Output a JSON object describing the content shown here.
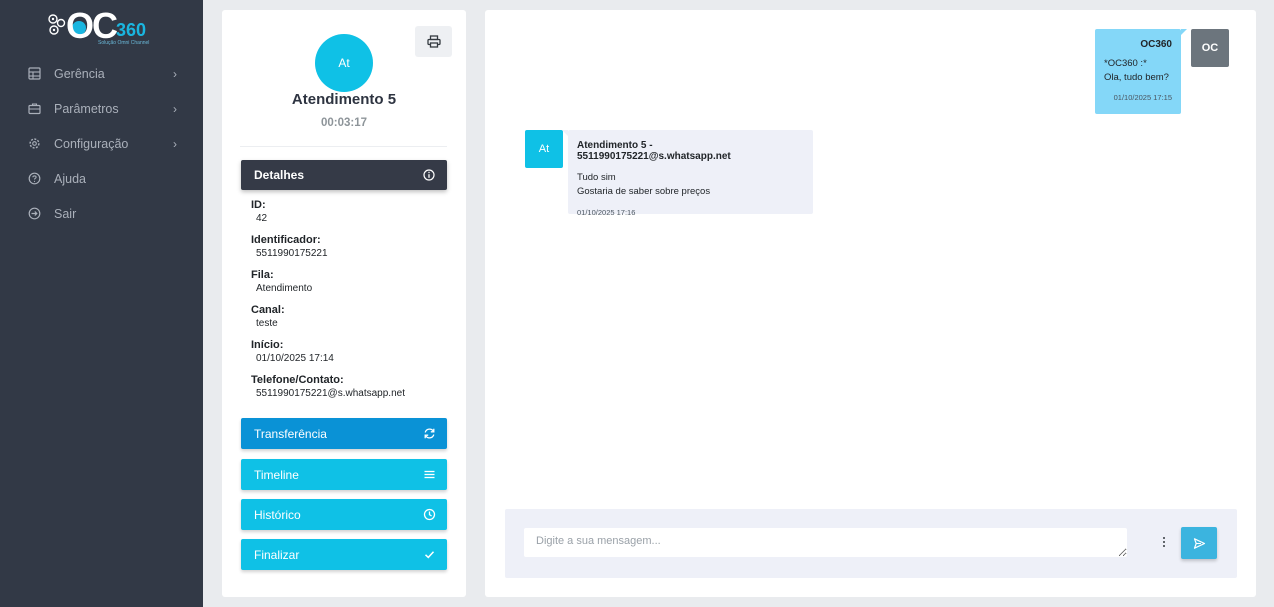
{
  "logo": {
    "brand": "OC",
    "number": "360",
    "tagline": "Solução Omni Channel"
  },
  "sidebar": {
    "items": [
      {
        "label": "Gerência",
        "icon": "server-icon",
        "has_submenu": true
      },
      {
        "label": "Parâmetros",
        "icon": "briefcase-icon",
        "has_submenu": true
      },
      {
        "label": "Configuração",
        "icon": "gear-icon",
        "has_submenu": true
      },
      {
        "label": "Ajuda",
        "icon": "help-circle-icon",
        "has_submenu": false
      },
      {
        "label": "Sair",
        "icon": "logout-icon",
        "has_submenu": false
      }
    ]
  },
  "contact": {
    "avatar_initials": "At",
    "name": "Atendimento 5",
    "timer": "00:03:17"
  },
  "details": {
    "header": "Detalhes",
    "fields": [
      {
        "label": "ID:",
        "value": "42"
      },
      {
        "label": "Identificador:",
        "value": "5511990175221"
      },
      {
        "label": "Fila:",
        "value": "Atendimento"
      },
      {
        "label": "Canal:",
        "value": "teste"
      },
      {
        "label": "Início:",
        "value": "01/10/2025 17:14"
      },
      {
        "label": "Telefone/Contato:",
        "value": "5511990175221@s.whatsapp.net"
      }
    ]
  },
  "actions": {
    "transfer": "Transferência",
    "timeline": "Timeline",
    "history": "Histórico",
    "finish": "Finalizar"
  },
  "chat": {
    "outgoing": {
      "avatar": "OC",
      "sender": "OC360",
      "line1": "*OC360 :*",
      "line2": "Ola, tudo bem?",
      "time": "01/10/2025 17:15"
    },
    "incoming": {
      "avatar": "At",
      "sender": "Atendimento 5 - 5511990175221@s.whatsapp.net",
      "line1": "Tudo sim",
      "line2": "Gostaria de saber sobre preços",
      "time": "01/10/2025 17:16"
    }
  },
  "compose": {
    "placeholder": "Digite a sua mensagem...",
    "value": ""
  },
  "colors": {
    "sidebar_bg": "#323946",
    "accent_cyan": "#0fc1e6",
    "transfer_blue": "#0a92d6",
    "details_dark": "#353a47",
    "outgoing_bubble": "#84d7f8",
    "incoming_bubble": "#eef0f8"
  }
}
